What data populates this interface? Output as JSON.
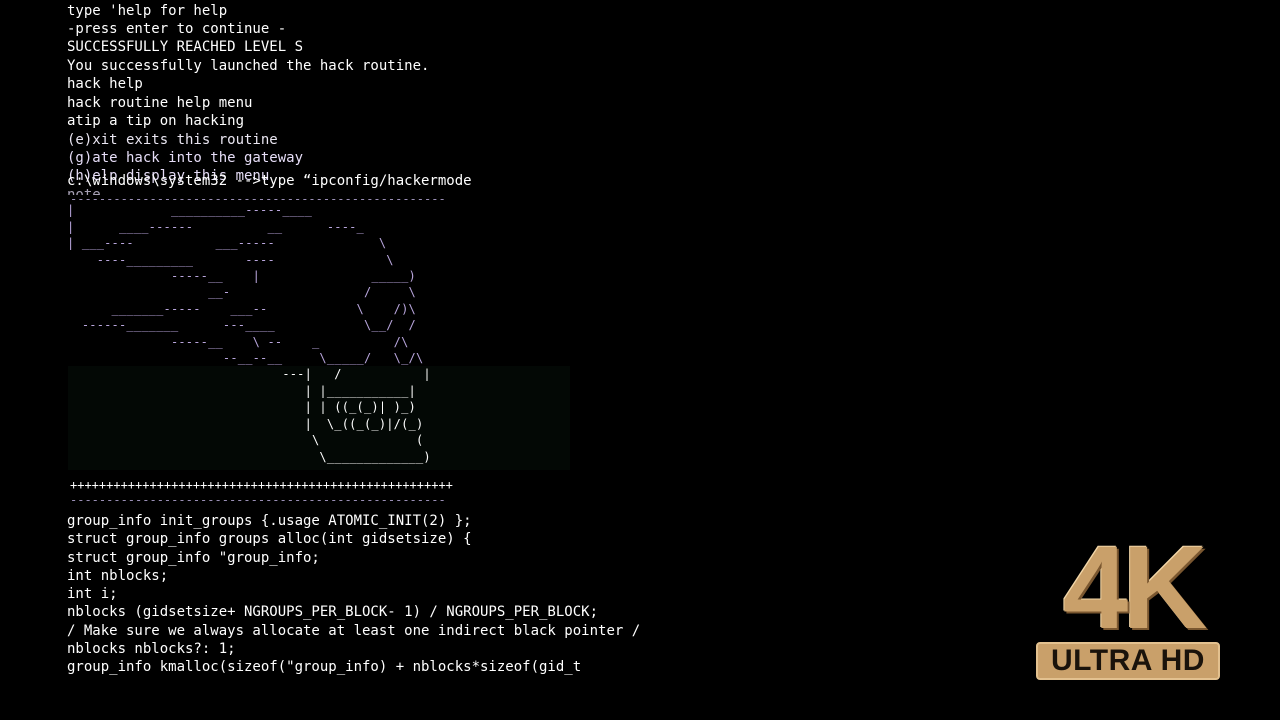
{
  "terminal": {
    "header_lines": [
      "type 'help for help",
      "-press enter to continue -",
      "SUCCESSFULLY REACHED LEVEL S",
      "You successfully launched the hack routine.",
      "hack help",
      "hack routine help menu",
      "atip a tip on hacking",
      "(e)xit exits this routine",
      "(g)ate hack into the gateway"
    ],
    "overlap_line_a": "(h)elp display this menu",
    "overlap_line_b": "c:\\windows\\system32 -->type “ipconfig/hackermode",
    "ghost_line": "note",
    "ascii_art": [
      "",
      "|             __________-----____",
      "|      ____------          __      ----_",
      "| ___----           ___-----              \\",
      "    ----_________       ----               \\",
      "              -----__    |               _____)",
      "                   __-                  /     \\",
      "      _______-----    ___--            \\    /)\\",
      "  ------_______      ---____            \\__/  /",
      "              -----__    \\ --    _          /\\",
      "                     --__--__     \\_____/   \\_/\\",
      "                             ---|   /           |",
      "                                | |___________|",
      "                                | | ((_(_)| )_)",
      "                                |  \\_((_(_)|/(_)",
      "                                 \\             (",
      "                                  \\_____________)"
    ],
    "rule_top": "----------------------------------------------------",
    "rule_plus": "+++++++++++++++++++++++++++++++++++++++++++++++++++++",
    "rule_bottom": "----------------------------------------------------",
    "code_lines": [
      "group_info init_groups {.usage ATOMIC_INIT(2) };",
      "struct group_info groups alloc(int gidsetsize) {",
      "struct group_info \"group_info;",
      "int nblocks;",
      "int i;",
      "nblocks (gidsetsize+ NGROUPS_PER_BLOCK- 1) / NGROUPS_PER_BLOCK;",
      "/ Make sure we always allocate at least one indirect black pointer /",
      "nblocks nblocks?: 1;",
      "group_info kmalloc(sizeof(\"group_info) + nblocks*sizeof(gid_t"
    ]
  },
  "badge": {
    "title": "4K",
    "subtitle": "ULTRA HD",
    "gold": "#c9a06a"
  }
}
